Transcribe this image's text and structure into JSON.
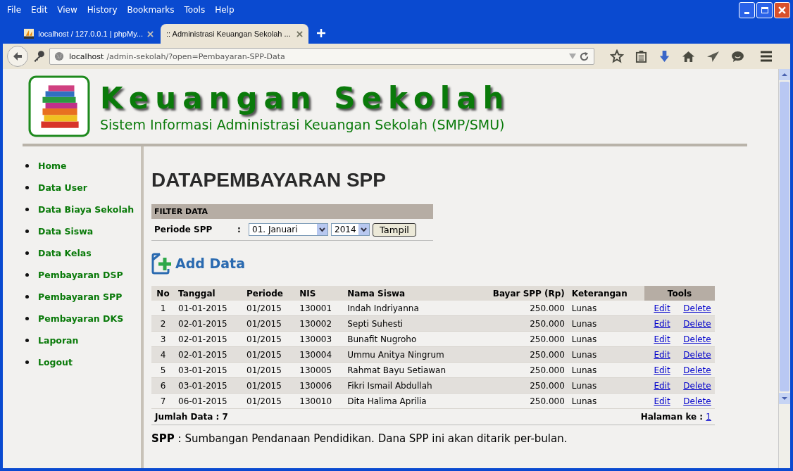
{
  "menu": [
    "File",
    "Edit",
    "View",
    "History",
    "Bookmarks",
    "Tools",
    "Help"
  ],
  "tabs": [
    {
      "title": "localhost / 127.0.0.1 | phpMy...",
      "selected": false,
      "kind": "pma"
    },
    {
      "title": ":: Administrasi Keuangan Sekolah ...",
      "selected": true,
      "kind": "page"
    }
  ],
  "address": {
    "host": "localhost",
    "path": "/admin-sekolah/?open=Pembayaran-SPP-Data"
  },
  "header": {
    "title": "Keuangan Sekolah",
    "subtitle": "Sistem Informasi Administrasi Keuangan Sekolah (SMP/SMU)"
  },
  "sidebar": [
    "Home",
    "Data User",
    "Data Biaya Sekolah",
    "Data Siswa",
    "Data Kelas",
    "Pembayaran DSP",
    "Pembayaran SPP",
    "Pembayaran DKS",
    "Laporan",
    "Logout"
  ],
  "heading": "DATAPEMBAYARAN SPP",
  "filter": {
    "title": "FILTER DATA",
    "label": "Periode SPP",
    "colon": ":",
    "month": "01. Januari",
    "year": "2014",
    "button": "Tampil"
  },
  "add_label": "Add Data",
  "table": {
    "columns": [
      "No",
      "Tanggal",
      "Periode",
      "NIS",
      "Nama Siswa",
      "Bayar SPP (Rp)",
      "Keterangan",
      "Tools"
    ],
    "rows": [
      {
        "cells": [
          "1",
          "01-01-2015",
          "01/2015",
          "130001",
          "Indah Indriyanna",
          "250.000",
          "Lunas"
        ],
        "actions": [
          "Edit",
          "Delete"
        ]
      },
      {
        "cells": [
          "2",
          "02-01-2015",
          "01/2015",
          "130002",
          "Septi Suhesti",
          "250.000",
          "Lunas"
        ],
        "actions": [
          "Edit",
          "Delete"
        ]
      },
      {
        "cells": [
          "3",
          "02-01-2015",
          "01/2015",
          "130003",
          "Bunafit Nugroho",
          "250.000",
          "Lunas"
        ],
        "actions": [
          "Edit",
          "Delete"
        ]
      },
      {
        "cells": [
          "4",
          "02-01-2015",
          "01/2015",
          "130004",
          "Ummu Anitya Ningrum",
          "250.000",
          "Lunas"
        ],
        "actions": [
          "Edit",
          "Delete"
        ]
      },
      {
        "cells": [
          "5",
          "03-01-2015",
          "01/2015",
          "130005",
          "Rahmat Bayu Setiawan",
          "250.000",
          "Lunas"
        ],
        "actions": [
          "Edit",
          "Delete"
        ]
      },
      {
        "cells": [
          "6",
          "03-01-2015",
          "01/2015",
          "130006",
          "Fikri Ismail Abdullah",
          "250.000",
          "Lunas"
        ],
        "actions": [
          "Edit",
          "Delete"
        ]
      },
      {
        "cells": [
          "7",
          "06-01-2015",
          "01/2015",
          "130010",
          "Dita Halima Aprilia",
          "250.000",
          "Lunas"
        ],
        "actions": [
          "Edit",
          "Delete"
        ]
      }
    ],
    "total": "Jumlah Data : 7",
    "page_label": "Halaman ke :",
    "page_link": "1"
  },
  "note": "**SPP** : Sumbangan Pendanaan Pendidikan. Dana SPP ini akan ditarik per-bulan."
}
